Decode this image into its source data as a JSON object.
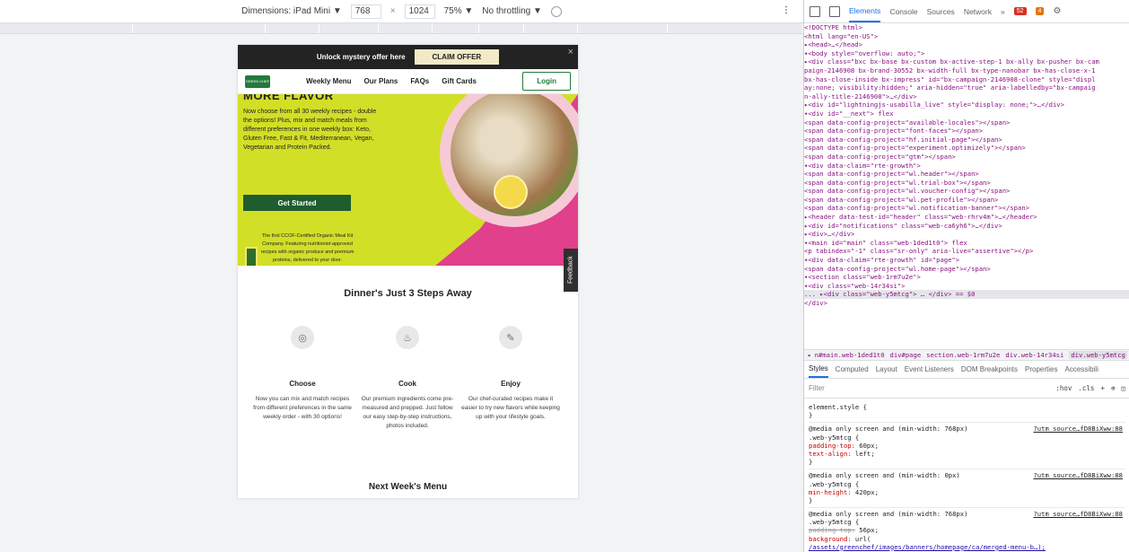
{
  "emulation": {
    "dimensions_label": "Dimensions: iPad Mini ▼",
    "width": "768",
    "times": "×",
    "height": "1024",
    "zoom": "75% ▼",
    "throttling": "No throttling ▼",
    "more": "⋮"
  },
  "page": {
    "promo_text": "Unlock mystery offer here",
    "claim_label": "CLAIM OFFER",
    "close": "×",
    "logo_text": "GREEN CHEF",
    "nav": [
      "Weekly Menu",
      "Our Plans",
      "FAQs",
      "Gift Cards"
    ],
    "login": "Login",
    "hero_heading": "MORE FLAVOR",
    "hero_copy": "Now choose from all 30 weekly recipes - double the options! Plus, mix and match meals from different preferences in one weekly box: Keto, Gluten Free, Fast & Fit, Mediterranean, Vegan, Vegetarian and Protein Packed.",
    "cta": "Get Started",
    "ccof_copy": "The first CCOF-Certified Organic Meal Kit Company. Featuring nutritionist-approved recipes with organic produce and premium proteins, delivered to your door.",
    "feedback": "Feedback",
    "steps_title": "Dinner's Just 3 Steps Away",
    "steps": [
      {
        "name": "Choose",
        "desc": "Now you can mix and match recipes from different preferences in the same weekly order - with 30 options!"
      },
      {
        "name": "Cook",
        "desc": "Our premium ingredients come pre-measured and prepped. Just follow our easy step-by-step instructions, photos included."
      },
      {
        "name": "Enjoy",
        "desc": "Our chef-curated recipes make it easier to try new flavors while keeping up with your lifestyle goals."
      }
    ],
    "next_week": "Next Week's Menu",
    "colors": {
      "lime": "#d2df27",
      "pink": "#e0408c",
      "green": "#1e5d2e",
      "dark": "#232323"
    }
  },
  "devtools": {
    "tabs": [
      "Elements",
      "Console",
      "Sources",
      "Network",
      "»"
    ],
    "errors": "52",
    "warnings": "4",
    "dom": [
      "<!DOCTYPE html>",
      "<html lang=\"en-US\">",
      "▸<head>…</head>",
      "▾<body style=\"overflow: auto;\">",
      "  ▸<div class=\"bxc bx-base bx-custom bx-active-step-1 bx-ally bx-pusher bx-cam",
      "   paign-2146908 bx-brand-30552 bx-width-full bx-type-nanobar bx-has-close-x-1",
      "   bx-has-close-inside bx-impress\" id=\"bx-campaign-2146908-clone\" style=\"displ",
      "   ay:none; visibility:hidden;\" aria-hidden=\"true\" aria-labelledby=\"bx-campaig",
      "   n-ally-title-2146908\">…</div>",
      "  ▸<div id=\"lightningjs-usabilla_live\" style=\"display: none;\">…</div>",
      "  ▾<div id=\"__next\"> flex",
      "      <span data-config-project=\"available-locales\"></span>",
      "      <span data-config-project=\"font-faces\"></span>",
      "      <span data-config-project=\"hf.initial-page\"></span>",
      "      <span data-config-project=\"experiment.optimizely\"></span>",
      "      <span data-config-project=\"gtm\"></span>",
      "    ▾<div data-claim=\"rte-growth\">",
      "        <span data-config-project=\"wl.header\"></span>",
      "        <span data-config-project=\"wl.trial-box\"></span>",
      "        <span data-config-project=\"wl.voucher-config\"></span>",
      "        <span data-config-project=\"wl.pet-profile\"></span>",
      "        <span data-config-project=\"wl.notification-banner\"></span>",
      "      ▸<header data-test-id=\"header\" class=\"web-rhrv4m\">…</header>",
      "      ▸<div id=\"notifications\" class=\"web-ca6yh6\">…</div>",
      "      ▸<div>…</div>",
      "      ▾<main id=\"main\" class=\"web-1ded1t0\"> flex",
      "          <p tabindex=\"-1\" class=\"sr-only\" aria-live=\"assertive\"></p>",
      "        ▾<div data-claim=\"rte-growth\" id=\"page\">",
      "            <span data-config-project=\"wl.home-page\"></span>",
      "          ▾<section class=\"web-1rm7u2e\">",
      "            ▾<div class=\"web-14r34si\">",
      "...            ▸<div class=\"web-y5mtcg\"> … </div> == $0",
      "              </div>"
    ],
    "crumbs": [
      "◂ n#main.web-1ded1t0",
      "div#page",
      "section.web-1rm7u2e",
      "div.web-14r34si",
      "div.web-y5mtcg"
    ],
    "sub_tabs": [
      "Styles",
      "Computed",
      "Layout",
      "Event Listeners",
      "DOM Breakpoints",
      "Properties",
      "Accessibili"
    ],
    "filter": "Filter",
    "filter_tools": [
      ":hov",
      ".cls",
      "+",
      "⊕",
      "◫"
    ],
    "rules": [
      {
        "lines": [
          "element.style {",
          "}"
        ],
        "src": ""
      },
      {
        "lines": [
          "@media only screen and (min-width: 768px)",
          ".web-y5mtcg {",
          "  padding-top: 60px;",
          "  text-align: left;",
          "}"
        ],
        "src": "?utm_source…fD8BiXww:88"
      },
      {
        "lines": [
          "@media only screen and (min-width: 0px)",
          ".web-y5mtcg {",
          "  min-height: 420px;",
          "}"
        ],
        "src": "?utm_source…fD8BiXww:88"
      },
      {
        "lines": [
          "@media only screen and (min-width: 768px)",
          ".web-y5mtcg {",
          "  padding-top: 56px;",
          "  background: url(",
          "    /assets/greenchef/images/banners/homepage/ca/merged-menu-b…);"
        ],
        "src": "?utm_source…fD8BiXww:88"
      }
    ]
  }
}
